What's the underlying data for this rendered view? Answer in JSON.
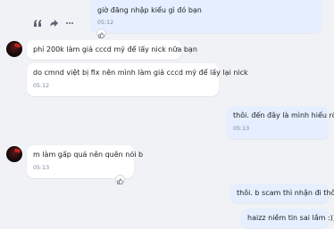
{
  "messages": [
    {
      "id": "m1",
      "side": "out",
      "text": "giờ đăng nhập kiểu gì đó bạn",
      "time": "05:12"
    },
    {
      "id": "m2",
      "side": "in",
      "text": "phí 200k làm giả cccd mỹ để lấy nick nữa bạn",
      "time": ""
    },
    {
      "id": "m3",
      "side": "in",
      "text": "do cmnd việt bị fix nên mình làm giả cccd mỹ để lấy lại nick",
      "time": "05:12"
    },
    {
      "id": "m4",
      "side": "out",
      "text": "thôi. đến đây là mình hiểu rồi",
      "time": "05:13"
    },
    {
      "id": "m5",
      "side": "in",
      "text": "m làm gấp quá nên quên nói b",
      "time": "05:13"
    },
    {
      "id": "m6",
      "side": "out",
      "text": "thôi. b scam thì nhận đi thôi",
      "time": ""
    },
    {
      "id": "m7",
      "side": "out",
      "text": "haizz niềm tin sai lầm :))))",
      "time": ""
    }
  ],
  "colors": {
    "background": "#f0f2f5",
    "bubble_in": "#ffffff",
    "bubble_out": "#e5efff",
    "time_text": "#7b8594",
    "icon": "#5a6372"
  },
  "icons": {
    "reaction": "thumbs-up-icon",
    "quote": "quote-icon",
    "forward": "forward-icon",
    "more": "more-icon"
  }
}
